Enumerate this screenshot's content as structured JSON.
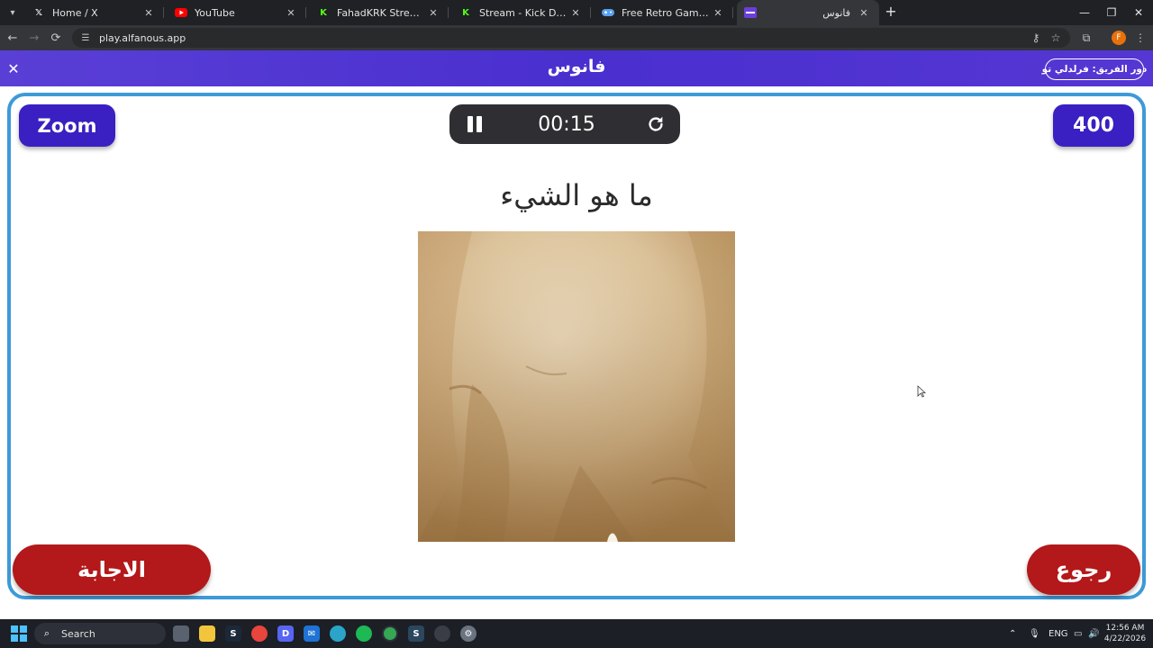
{
  "browser": {
    "tabs": [
      {
        "title": "Home / X",
        "icon": "x-logo-icon"
      },
      {
        "title": "YouTube",
        "icon": "youtube-icon"
      },
      {
        "title": "FahadKRK Stream - Watch Live",
        "icon": "kick-icon"
      },
      {
        "title": "Stream - Kick Dashboard",
        "icon": "kick-icon"
      },
      {
        "title": "Free Retro Game Collection - Pl",
        "icon": "game-icon"
      },
      {
        "title": "فانوس",
        "icon": "alfanous-icon",
        "active": true
      }
    ],
    "url": "play.alfanous.app",
    "profile_initial": "F"
  },
  "app": {
    "logo": "فانوس",
    "turn_label": "دور الفريق: فرلدلي تو",
    "zoom_label": "Zoom",
    "score": "400",
    "timer": "00:15",
    "question": "ما هو الشيء",
    "answer_label": "الاجابة",
    "back_label": "رجوع"
  },
  "taskbar": {
    "search_label": "Search",
    "language": "ENG",
    "time": "12:56 AM",
    "date": "4/22/2026"
  },
  "colors": {
    "header": "#4a2fcf",
    "primary_button": "#3a1fc2",
    "danger_button": "#b3181a",
    "board_border": "#3d9ad8",
    "timer_bg": "#2f2f33"
  }
}
